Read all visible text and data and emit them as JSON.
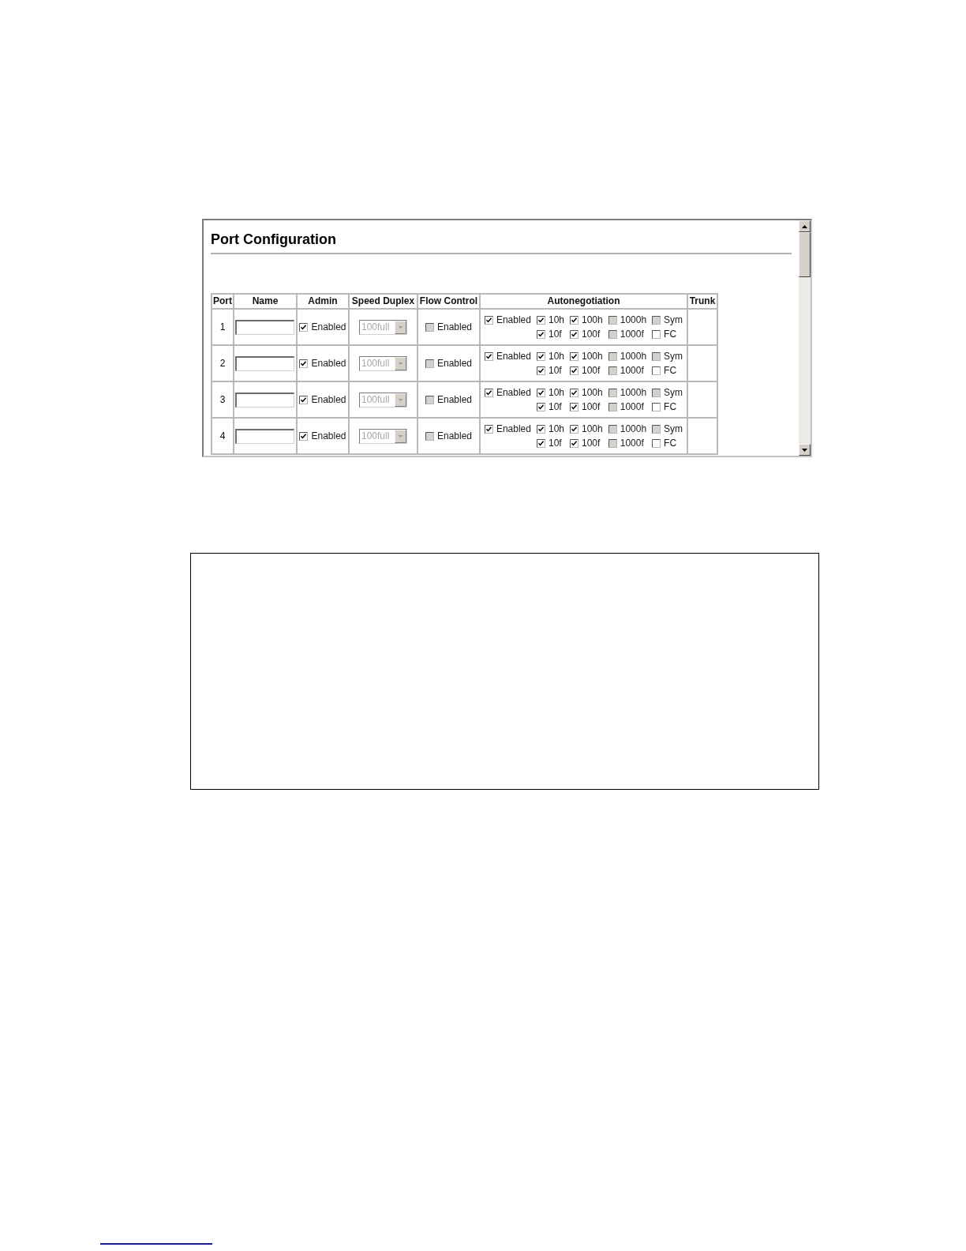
{
  "title": "Port Configuration",
  "table": {
    "columns": [
      "Port",
      "Name",
      "Admin",
      "Speed Duplex",
      "Flow Control",
      "Autonegotiation",
      "Trunk"
    ],
    "rows": [
      {
        "port": "1",
        "admin": {
          "label": "Enabled",
          "checked": true,
          "disabled": false
        },
        "speed_duplex": {
          "value": "100full",
          "disabled": true
        },
        "flow_control": {
          "label": "Enabled",
          "checked": false,
          "disabled": true
        },
        "autonegotiation": {
          "enabled": {
            "label": "Enabled",
            "checked": true,
            "disabled": false
          },
          "options": [
            {
              "label": "10h",
              "checked": true,
              "disabled": false
            },
            {
              "label": "100h",
              "checked": true,
              "disabled": false
            },
            {
              "label": "1000h",
              "checked": false,
              "disabled": true
            },
            {
              "label": "Sym",
              "checked": false,
              "disabled": true
            },
            {
              "label": "10f",
              "checked": true,
              "disabled": false
            },
            {
              "label": "100f",
              "checked": true,
              "disabled": false
            },
            {
              "label": "1000f",
              "checked": false,
              "disabled": true
            },
            {
              "label": "FC",
              "checked": false,
              "disabled": false
            }
          ]
        }
      },
      {
        "port": "2",
        "admin": {
          "label": "Enabled",
          "checked": true,
          "disabled": false
        },
        "speed_duplex": {
          "value": "100full",
          "disabled": true
        },
        "flow_control": {
          "label": "Enabled",
          "checked": false,
          "disabled": true
        },
        "autonegotiation": {
          "enabled": {
            "label": "Enabled",
            "checked": true,
            "disabled": false
          },
          "options": [
            {
              "label": "10h",
              "checked": true,
              "disabled": false
            },
            {
              "label": "100h",
              "checked": true,
              "disabled": false
            },
            {
              "label": "1000h",
              "checked": false,
              "disabled": true
            },
            {
              "label": "Sym",
              "checked": false,
              "disabled": true
            },
            {
              "label": "10f",
              "checked": true,
              "disabled": false
            },
            {
              "label": "100f",
              "checked": true,
              "disabled": false
            },
            {
              "label": "1000f",
              "checked": false,
              "disabled": true
            },
            {
              "label": "FC",
              "checked": false,
              "disabled": false
            }
          ]
        }
      },
      {
        "port": "3",
        "admin": {
          "label": "Enabled",
          "checked": true,
          "disabled": false
        },
        "speed_duplex": {
          "value": "100full",
          "disabled": true
        },
        "flow_control": {
          "label": "Enabled",
          "checked": false,
          "disabled": true
        },
        "autonegotiation": {
          "enabled": {
            "label": "Enabled",
            "checked": true,
            "disabled": false
          },
          "options": [
            {
              "label": "10h",
              "checked": true,
              "disabled": false
            },
            {
              "label": "100h",
              "checked": true,
              "disabled": false
            },
            {
              "label": "1000h",
              "checked": false,
              "disabled": true
            },
            {
              "label": "Sym",
              "checked": false,
              "disabled": true
            },
            {
              "label": "10f",
              "checked": true,
              "disabled": false
            },
            {
              "label": "100f",
              "checked": true,
              "disabled": false
            },
            {
              "label": "1000f",
              "checked": false,
              "disabled": true
            },
            {
              "label": "FC",
              "checked": false,
              "disabled": false
            }
          ]
        }
      },
      {
        "port": "4",
        "admin": {
          "label": "Enabled",
          "checked": true,
          "disabled": false
        },
        "speed_duplex": {
          "value": "100full",
          "disabled": true
        },
        "flow_control": {
          "label": "Enabled",
          "checked": false,
          "disabled": true
        },
        "autonegotiation": {
          "enabled": {
            "label": "Enabled",
            "checked": true,
            "disabled": false
          },
          "options": [
            {
              "label": "10h",
              "checked": true,
              "disabled": false
            },
            {
              "label": "100h",
              "checked": true,
              "disabled": false
            },
            {
              "label": "1000h",
              "checked": false,
              "disabled": true
            },
            {
              "label": "Sym",
              "checked": false,
              "disabled": true
            },
            {
              "label": "10f",
              "checked": true,
              "disabled": false
            },
            {
              "label": "100f",
              "checked": true,
              "disabled": false
            },
            {
              "label": "1000f",
              "checked": false,
              "disabled": true
            },
            {
              "label": "FC",
              "checked": false,
              "disabled": false
            }
          ]
        }
      }
    ]
  }
}
